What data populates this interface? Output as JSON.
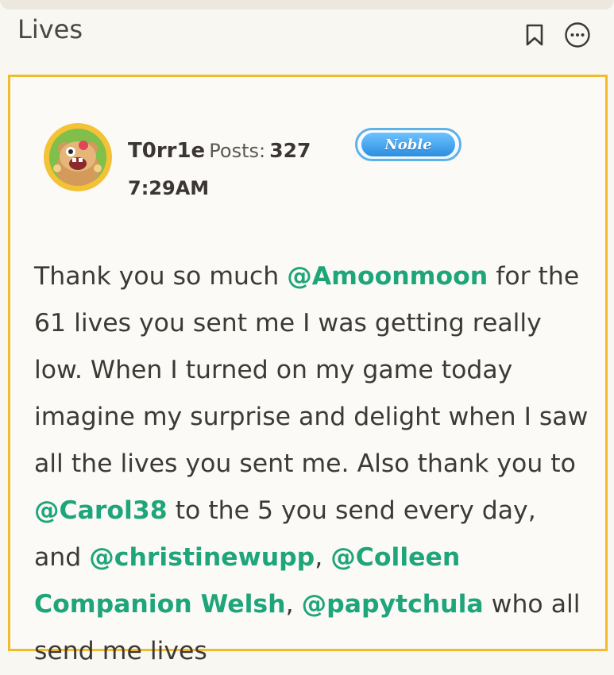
{
  "header": {
    "title": "Lives",
    "bookmark_icon": "bookmark-icon",
    "more_icon": "more-options-icon"
  },
  "post": {
    "author": {
      "username": "T0rr1e",
      "posts_label": "Posts:",
      "posts_count": "327",
      "rank_badge": "Noble",
      "timestamp": "7:29AM",
      "avatar_icon": "candy-creature-avatar"
    },
    "body": [
      {
        "type": "text",
        "value": "Thank you so much "
      },
      {
        "type": "mention",
        "value": "@Amoonmoon"
      },
      {
        "type": "text",
        "value": " for the 61 lives you sent me I was getting really low. When I turned on my game today imagine my surprise and delight when I saw all the lives you sent me. Also thank you to "
      },
      {
        "type": "mention",
        "value": "@Carol38"
      },
      {
        "type": "text",
        "value": " to the 5 you send every day, and "
      },
      {
        "type": "mention",
        "value": "@christinewupp"
      },
      {
        "type": "text",
        "value": ", "
      },
      {
        "type": "mention",
        "value": "@Colleen Companion Welsh"
      },
      {
        "type": "text",
        "value": ", "
      },
      {
        "type": "mention",
        "value": "@papytchula"
      },
      {
        "type": "text",
        "value": " who all send me lives"
      }
    ]
  },
  "colors": {
    "card_border": "#f2bb2a",
    "mention": "#1ea57a",
    "badge_blue": "#2c8fe0",
    "background": "#f9f7f2"
  }
}
